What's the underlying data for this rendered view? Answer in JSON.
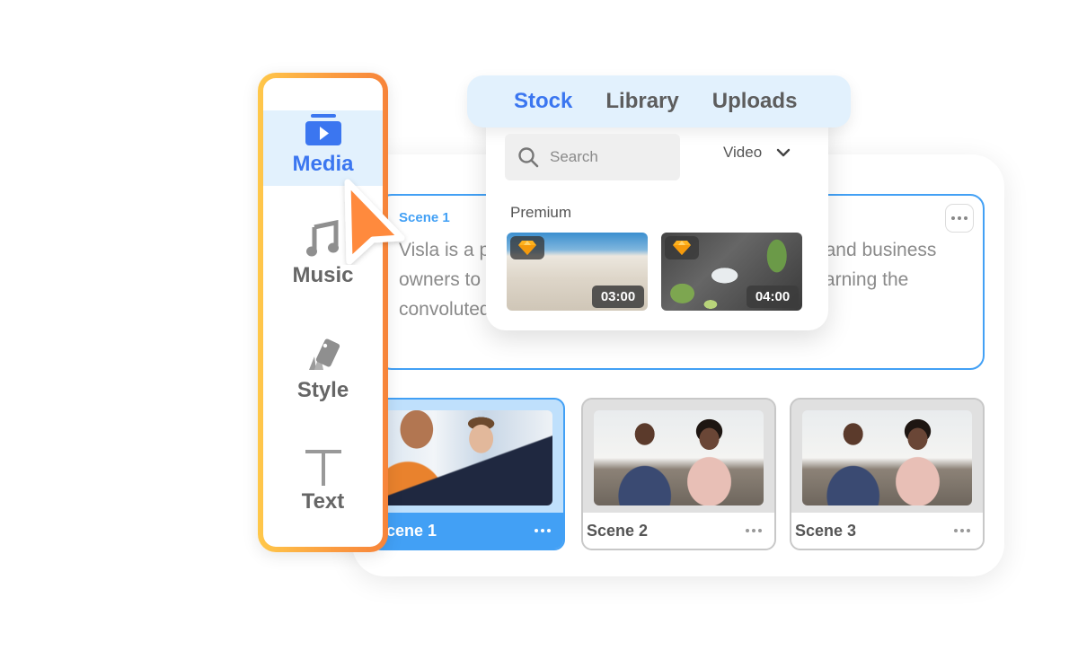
{
  "sidebar": {
    "items": [
      {
        "label": "Media",
        "icon": "media-play-icon",
        "active": true
      },
      {
        "label": "Music",
        "icon": "music-note-icon",
        "active": false
      },
      {
        "label": "Style",
        "icon": "style-swatch-icon",
        "active": false
      },
      {
        "label": "Text",
        "icon": "text-t-icon",
        "active": false
      }
    ]
  },
  "media_panel": {
    "tabs": [
      {
        "label": "Stock",
        "active": true
      },
      {
        "label": "Library",
        "active": false
      },
      {
        "label": "Uploads",
        "active": false
      }
    ],
    "search": {
      "placeholder": "Search",
      "value": ""
    },
    "type_select": {
      "value": "Video"
    },
    "section_label": "Premium",
    "items": [
      {
        "description": "desert dunes",
        "duration": "03:00",
        "premium": true
      },
      {
        "description": "cocktail glass with limes",
        "duration": "04:00",
        "premium": true
      }
    ]
  },
  "scene_editor": {
    "scene_label": "Scene 1",
    "text": "Visla is a platform that empowers digital marketers and business owners to help them create videos easily without learning the convoluted interfaces of other editing softwares."
  },
  "scenes": [
    {
      "name": "Scene 1",
      "active": true
    },
    {
      "name": "Scene 2",
      "active": false
    },
    {
      "name": "Scene 3",
      "active": false
    }
  ],
  "colors": {
    "accent_blue": "#3b76f0",
    "scene_blue": "#42a0f5",
    "sidebar_gradient_start": "#ffc84a",
    "sidebar_gradient_end": "#f7843a",
    "cursor_orange": "#ff8a3d",
    "premium_gold": "#ffb21e"
  }
}
